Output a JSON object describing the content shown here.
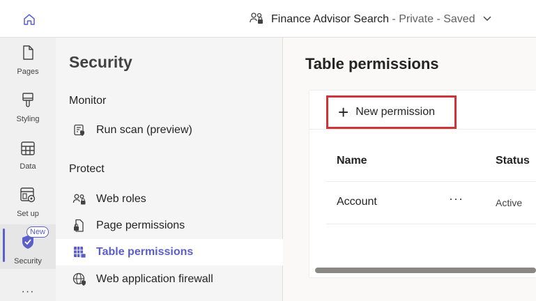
{
  "header": {
    "site_name": "Finance Advisor Search",
    "site_meta": " - Private - Saved"
  },
  "rail": {
    "items": [
      {
        "label": "Pages",
        "icon": "page-icon"
      },
      {
        "label": "Styling",
        "icon": "paintbrush-icon"
      },
      {
        "label": "Data",
        "icon": "table-icon"
      },
      {
        "label": "Set up",
        "icon": "settings-window-icon"
      },
      {
        "label": "Security",
        "icon": "shield-check-icon",
        "badge": "New",
        "active": true
      }
    ],
    "more": "···"
  },
  "subnav": {
    "title": "Security",
    "sections": [
      {
        "heading": "Monitor",
        "items": [
          {
            "label": "Run scan (preview)",
            "icon": "scan-icon"
          }
        ]
      },
      {
        "heading": "Protect",
        "items": [
          {
            "label": "Web roles",
            "icon": "people-lock-icon"
          },
          {
            "label": "Page permissions",
            "icon": "document-lock-icon"
          },
          {
            "label": "Table permissions",
            "icon": "table-lock-icon",
            "selected": true
          },
          {
            "label": "Web application firewall",
            "icon": "globe-shield-icon"
          }
        ]
      }
    ]
  },
  "main": {
    "title": "Table permissions",
    "new_button": "New permission",
    "columns": [
      "Name",
      "Status"
    ],
    "rows": [
      {
        "name": "Account",
        "more": "···",
        "status": "Active"
      }
    ]
  },
  "colors": {
    "accent": "#5b5fc7",
    "highlight_border": "#d13438"
  }
}
